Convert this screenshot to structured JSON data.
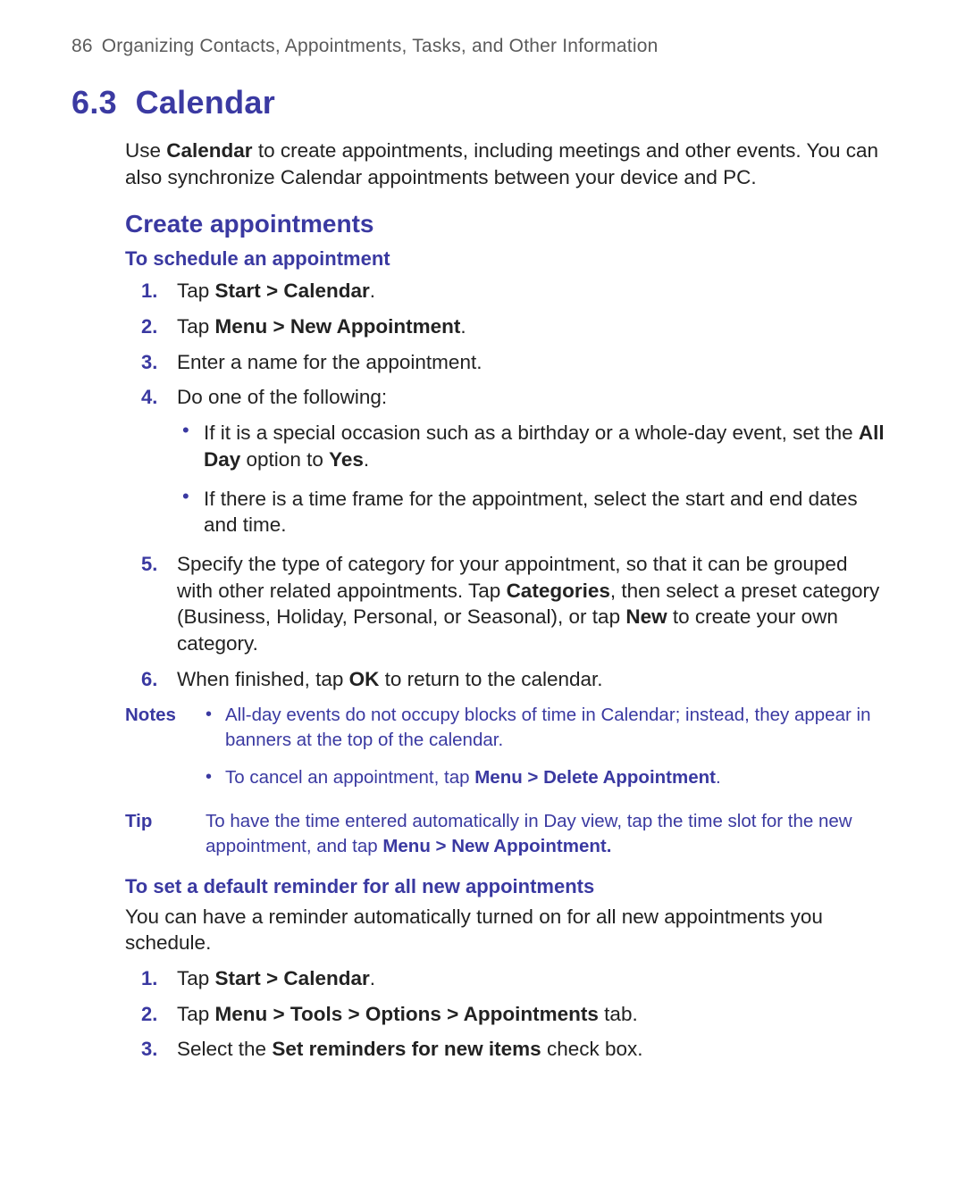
{
  "header": {
    "page_number": "86",
    "chapter_title": "Organizing Contacts, Appointments, Tasks, and Other Information"
  },
  "section": {
    "number": "6.3",
    "title": "Calendar"
  },
  "intro": {
    "pre": "Use ",
    "bold1": "Calendar",
    "post": " to create appointments, including meetings and other events. You can also synchronize Calendar appointments between your device and PC."
  },
  "subsection1": "Create appointments",
  "procedure1": {
    "title": "To schedule an appointment",
    "steps": {
      "s1": {
        "num": "1.",
        "pre": "Tap ",
        "bold": "Start > Calendar",
        "post": "."
      },
      "s2": {
        "num": "2.",
        "pre": "Tap ",
        "bold": "Menu > New Appointment",
        "post": "."
      },
      "s3": {
        "num": "3.",
        "text": "Enter a name for the appointment."
      },
      "s4": {
        "num": "4.",
        "text": "Do one of the following:",
        "sub": {
          "a": {
            "pre": "If it is a special occasion such as a birthday or a whole-day event, set the ",
            "b1": "All Day",
            "mid": " option to ",
            "b2": "Yes",
            "post": "."
          },
          "b": {
            "text": "If there is a time frame for the appointment, select the start and end dates and time."
          }
        }
      },
      "s5": {
        "num": "5.",
        "pre": "Specify the type of category for your appointment, so that it can be grouped with other related appointments. Tap ",
        "b1": "Categories",
        "mid": ", then select a preset category (Business, Holiday, Personal, or Seasonal), or tap ",
        "b2": "New",
        "post": " to create your own category."
      },
      "s6": {
        "num": "6.",
        "pre": "When finished, tap ",
        "b1": "OK",
        "post": " to return to the calendar."
      }
    }
  },
  "notes": {
    "label": "Notes",
    "items": {
      "n1": "All-day events do not occupy blocks of time in Calendar; instead, they appear in banners at the top of the calendar.",
      "n2": {
        "pre": "To cancel an appointment, tap ",
        "bold": "Menu > Delete Appointment",
        "post": "."
      }
    }
  },
  "tip": {
    "label": "Tip",
    "pre": "To have the time entered automatically in Day view, tap the time slot for the new appointment, and tap ",
    "bold": "Menu > New Appointment.",
    "post": ""
  },
  "procedure2": {
    "title": "To set a default reminder for all new appointments",
    "intro": "You can have a reminder automatically turned on for all new appointments you schedule.",
    "steps": {
      "s1": {
        "num": "1.",
        "pre": "Tap ",
        "bold": "Start > Calendar",
        "post": "."
      },
      "s2": {
        "num": "2.",
        "pre": "Tap ",
        "bold": "Menu > Tools > Options > Appointments",
        "post": " tab."
      },
      "s3": {
        "num": "3.",
        "pre": "Select the ",
        "bold": "Set reminders for new items",
        "post": " check box."
      }
    }
  }
}
